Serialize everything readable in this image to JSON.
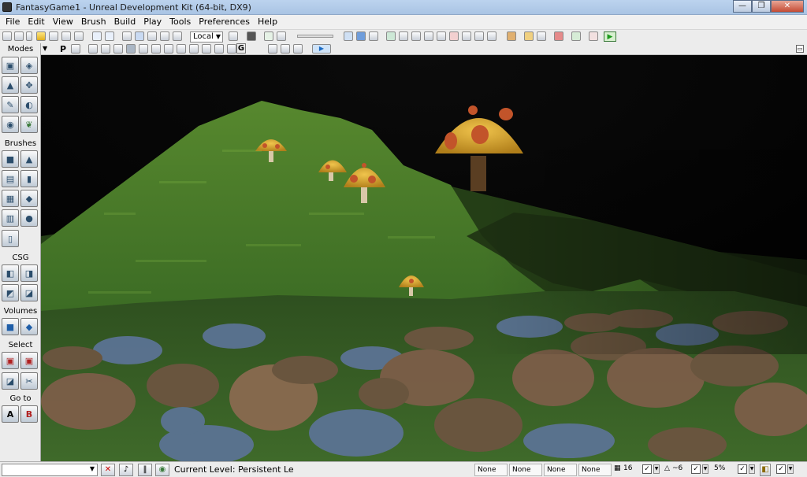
{
  "window": {
    "title": "FantasyGame1 - Unreal Development Kit (64-bit, DX9)",
    "controls": {
      "minimize": "—",
      "maximize": "❐",
      "close": "✕"
    }
  },
  "menu": [
    "File",
    "Edit",
    "View",
    "Brush",
    "Build",
    "Play",
    "Tools",
    "Preferences",
    "Help"
  ],
  "toolbar": {
    "coordinate_system": "Local",
    "play_symbol": "▶"
  },
  "toolbar2": {
    "perspective_label": "P",
    "grid_label": "G"
  },
  "modes_panel": {
    "title": "Modes",
    "sections": [
      "Brushes",
      "CSG",
      "Volumes",
      "Select",
      "Go to"
    ],
    "goto_buttons": [
      "A",
      "B"
    ]
  },
  "statusbar": {
    "current_level_label": "Current Level:",
    "current_level_value": "Persistent Le",
    "level_slots": [
      "None",
      "None",
      "None",
      "None"
    ],
    "grid_size": "16",
    "rotation_snap": "~6",
    "scale_snap": "5%"
  },
  "colors": {
    "titlebar": "#a9c4e4",
    "panel_bg": "#ececec",
    "terrain_green": "#3f6f25",
    "mushroom_cap": "#d8a830",
    "mushroom_spot": "#c2542a",
    "paving_brown": "#7c5e48",
    "paving_blue": "#5b7393"
  },
  "icons": {
    "app": "unreal-logo-icon",
    "new": "new-document-icon",
    "open": "open-folder-icon",
    "save": "save-icon",
    "undo": "undo-icon",
    "redo": "redo-icon",
    "select": "select-arrow-icon",
    "translate": "translate-icon",
    "rotate": "rotate-icon",
    "play": "play-icon"
  }
}
